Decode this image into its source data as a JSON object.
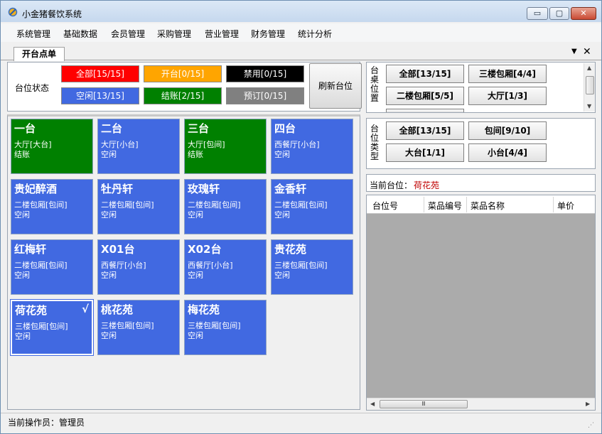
{
  "window": {
    "title": "小金猪餐饮系统",
    "controls": {
      "minimize": "▭",
      "maximize": "▢",
      "close": "✕"
    }
  },
  "menu": [
    "系统管理",
    "基础数据",
    "会员管理",
    "采购管理",
    "营业管理",
    "财务管理",
    "统计分析"
  ],
  "tabs": {
    "active": "开台点单",
    "dropdown_glyph": "▼",
    "close_glyph": "✕"
  },
  "status_panel": {
    "label": "台位状态",
    "buttons": [
      {
        "label": "全部[15/15]",
        "bg": "#ff0000",
        "fg": "#ffffff"
      },
      {
        "label": "开台[0/15]",
        "bg": "#ffa500",
        "fg": "#ffffff"
      },
      {
        "label": "禁用[0/15]",
        "bg": "#000000",
        "fg": "#ffffff"
      },
      {
        "label": "空闲[13/15]",
        "bg": "#4169e1",
        "fg": "#ffffff"
      },
      {
        "label": "结账[2/15]",
        "bg": "#008000",
        "fg": "#ffffff"
      },
      {
        "label": "预订[0/15]",
        "bg": "#808080",
        "fg": "#ffffff"
      }
    ],
    "refresh_label": "刷新台位"
  },
  "tables": [
    {
      "name": "一台",
      "area": "大厅[大台]",
      "status": "结账",
      "color": "#008000",
      "selected": false
    },
    {
      "name": "二台",
      "area": "大厅[小台]",
      "status": "空闲",
      "color": "#4169e1",
      "selected": false
    },
    {
      "name": "三台",
      "area": "大厅[包间]",
      "status": "结账",
      "color": "#008000",
      "selected": false
    },
    {
      "name": "四台",
      "area": "西餐厅[小台]",
      "status": "空闲",
      "color": "#4169e1",
      "selected": false
    },
    {
      "name": "贵妃醉酒",
      "area": "二楼包厢[包间]",
      "status": "空闲",
      "color": "#4169e1",
      "selected": false
    },
    {
      "name": "牡丹轩",
      "area": "二楼包厢[包间]",
      "status": "空闲",
      "color": "#4169e1",
      "selected": false
    },
    {
      "name": "玫瑰轩",
      "area": "二楼包厢[包间]",
      "status": "空闲",
      "color": "#4169e1",
      "selected": false
    },
    {
      "name": "金香轩",
      "area": "二楼包厢[包间]",
      "status": "空闲",
      "color": "#4169e1",
      "selected": false
    },
    {
      "name": "红梅轩",
      "area": "二楼包厢[包间]",
      "status": "空闲",
      "color": "#4169e1",
      "selected": false
    },
    {
      "name": "X01台",
      "area": "西餐厅[小台]",
      "status": "空闲",
      "color": "#4169e1",
      "selected": false
    },
    {
      "name": "X02台",
      "area": "西餐厅[小台]",
      "status": "空闲",
      "color": "#4169e1",
      "selected": false
    },
    {
      "name": "贵花苑",
      "area": "三楼包厢[包间]",
      "status": "空闲",
      "color": "#4169e1",
      "selected": false
    },
    {
      "name": "荷花苑",
      "area": "三楼包厢[包间]",
      "status": "空闲",
      "color": "#4169e1",
      "selected": true,
      "check": "√"
    },
    {
      "name": "桃花苑",
      "area": "三楼包厢[包间]",
      "status": "空闲",
      "color": "#4169e1",
      "selected": false
    },
    {
      "name": "梅花苑",
      "area": "三楼包厢[包间]",
      "status": "空闲",
      "color": "#4169e1",
      "selected": false
    }
  ],
  "location_group": {
    "label": "台桌位置",
    "buttons": [
      "全部[13/15]",
      "三楼包厢[4/4]",
      "二楼包厢[5/5]",
      "大厅[1/3]"
    ]
  },
  "type_group": {
    "label": "台位类型",
    "buttons": [
      "全部[13/15]",
      "包间[9/10]",
      "大台[1/1]",
      "小台[4/4]"
    ]
  },
  "current_table": {
    "label": "当前台位：",
    "value": "荷花苑"
  },
  "dish_grid": {
    "columns": [
      "台位号",
      "菜品编号",
      "菜品名称",
      "单价"
    ],
    "scroll_glyph": "Ⅲ"
  },
  "statusbar": {
    "operator": "当前操作员：管理员"
  }
}
